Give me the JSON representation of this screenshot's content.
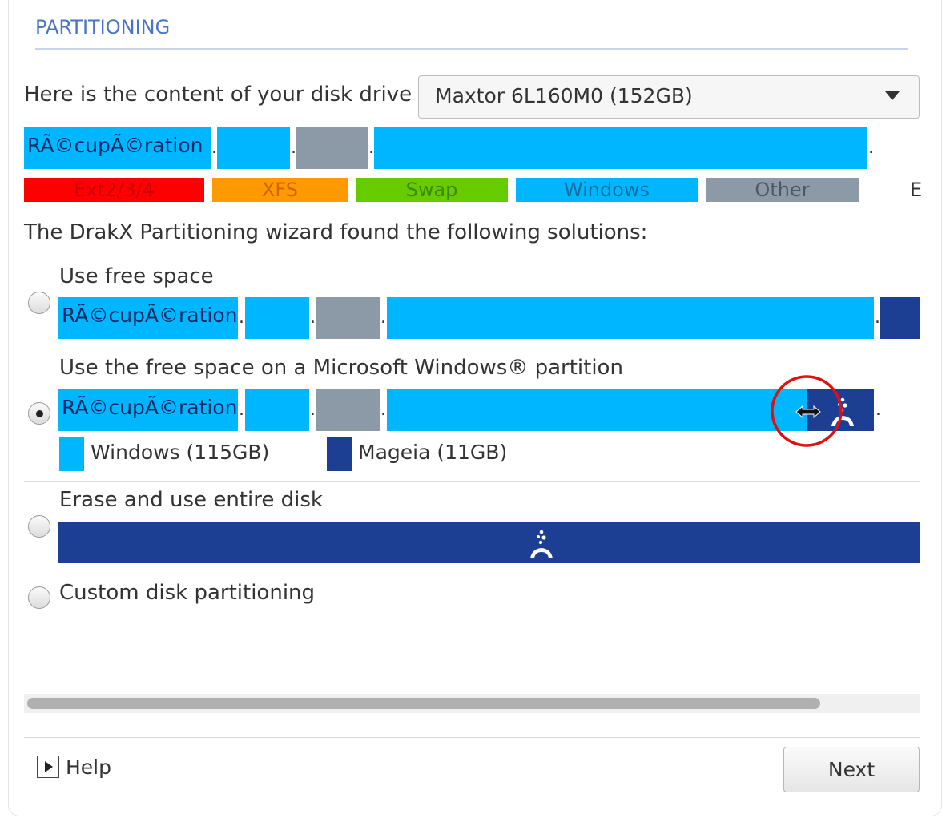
{
  "section_title": "PARTITIONING",
  "drive": {
    "label": "Here is the content of your disk drive",
    "selected": "Maxtor 6L160M0 (152GB)"
  },
  "partition_label": "RÃ©cupÃ©ration",
  "dot": ".",
  "legend": [
    "Ext2/3/4",
    "XFS",
    "Swap",
    "Windows",
    "Other",
    "E"
  ],
  "colors": {
    "ext": "#ff0000",
    "xfs": "#ff9900",
    "swap": "#66cc00",
    "windows": "#00b7ff",
    "other": "#8c99a6",
    "mageia": "#1c3f94",
    "accent": "#4a74c4"
  },
  "wizard_text": "The DrakX Partitioning wizard found the following solutions:",
  "options": {
    "free_space": "Use free space",
    "windows_resize": "Use the free space on a Microsoft Windows® partition",
    "erase": "Erase and use entire disk",
    "custom": "Custom disk partitioning"
  },
  "resize_legend": {
    "windows": "Windows (115GB)",
    "mageia": "Mageia (11GB)"
  },
  "icons": [
    "mageia-logo-icon",
    "resize-arrows-icon",
    "help-icon",
    "dropdown-caret-icon"
  ],
  "selected_option": "windows_resize",
  "footer": {
    "help": "Help",
    "next": "Next"
  }
}
